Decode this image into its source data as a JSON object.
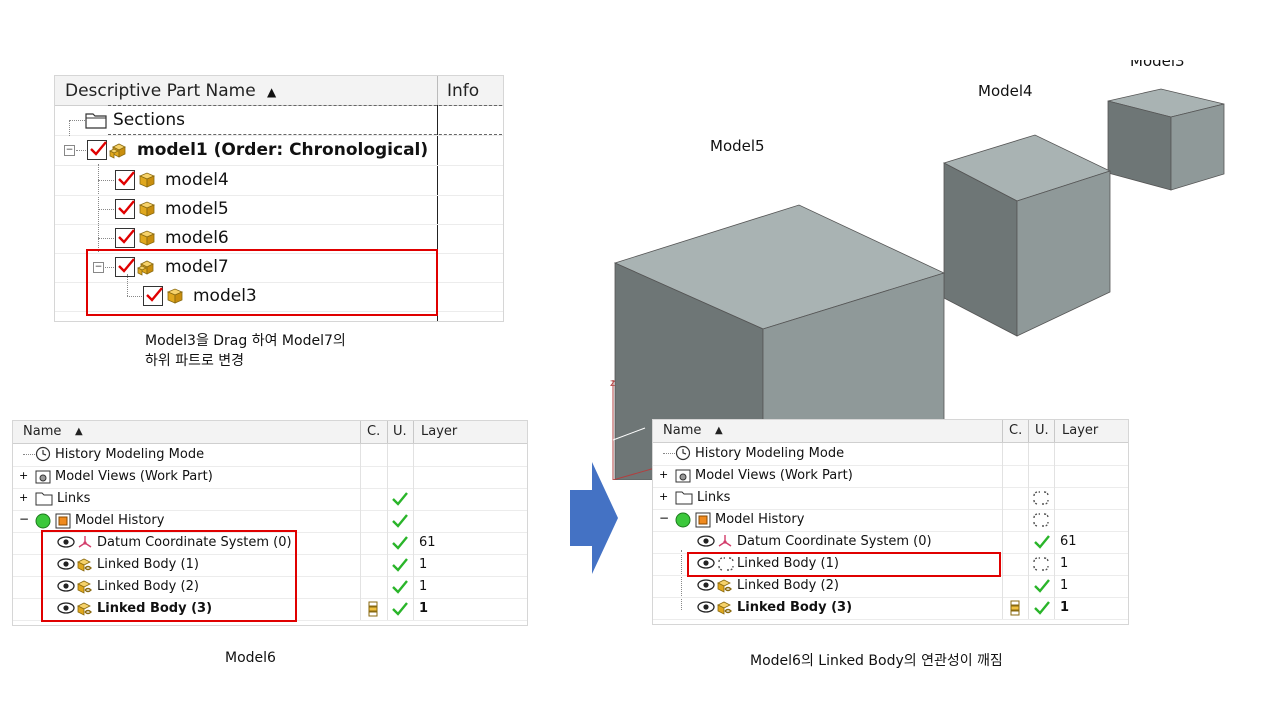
{
  "part_navigator": {
    "header": {
      "col_name": "Descriptive Part Name",
      "col_info": "Info"
    },
    "rows": [
      {
        "label": "Sections"
      },
      {
        "label": "model1 (Order: Chronological)"
      },
      {
        "label": "model4"
      },
      {
        "label": "model5"
      },
      {
        "label": "model6"
      },
      {
        "label": "model7"
      },
      {
        "label": "model3"
      }
    ],
    "caption_line1": "Model3을 Drag 하여 Model7의",
    "caption_line2": "하위 파트로 변경"
  },
  "model_nav_left": {
    "header": {
      "name": "Name",
      "c": "C.",
      "u": "U.",
      "layer": "Layer"
    },
    "rows": [
      {
        "label": "History Modeling Mode",
        "layer": ""
      },
      {
        "label": "Model Views (Work Part)",
        "layer": ""
      },
      {
        "label": "Links",
        "layer": ""
      },
      {
        "label": "Model History",
        "layer": ""
      },
      {
        "label": "Datum Coordinate System (0)",
        "layer": "61"
      },
      {
        "label": "Linked Body (1)",
        "layer": "1"
      },
      {
        "label": "Linked Body (2)",
        "layer": "1"
      },
      {
        "label": "Linked Body (3)",
        "layer": "1"
      }
    ],
    "caption": "Model6"
  },
  "model_nav_right": {
    "header": {
      "name": "Name",
      "c": "C.",
      "u": "U.",
      "layer": "Layer"
    },
    "rows": [
      {
        "label": "History Modeling Mode",
        "layer": ""
      },
      {
        "label": "Model Views (Work Part)",
        "layer": ""
      },
      {
        "label": "Links",
        "layer": ""
      },
      {
        "label": "Model History",
        "layer": ""
      },
      {
        "label": "Datum Coordinate System (0)",
        "layer": "61"
      },
      {
        "label": "Linked Body (1)",
        "layer": "1"
      },
      {
        "label": "Linked Body (2)",
        "layer": "1"
      },
      {
        "label": "Linked Body (3)",
        "layer": "1"
      }
    ],
    "caption": "Model6의 Linked Body의 연관성이 깨짐"
  },
  "scene": {
    "label_model5": "Model5",
    "label_model4": "Model4",
    "label_model3": "Model3"
  },
  "colors": {
    "highlight_red": "#e00000",
    "arrow_blue": "#4472c4",
    "cube_top": "#a9b3b3",
    "cube_left": "#6e7676",
    "cube_right": "#8f9999",
    "check_green": "#2ab52a"
  }
}
